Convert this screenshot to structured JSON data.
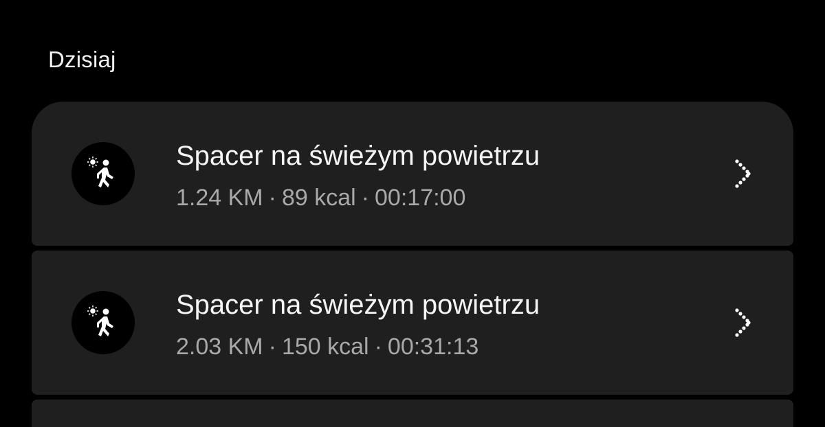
{
  "header": {
    "section_title": "Dzisiaj"
  },
  "activities": [
    {
      "title": "Spacer na świeżym powietrzu",
      "distance": "1.24 KM",
      "calories": "89 kcal",
      "duration": "00:17:00",
      "icon": "outdoor-walk-icon"
    },
    {
      "title": "Spacer na świeżym powietrzu",
      "distance": "2.03 KM",
      "calories": "150 kcal",
      "duration": "00:31:13",
      "icon": "outdoor-walk-icon"
    }
  ],
  "separator": "·",
  "colors": {
    "background": "#000000",
    "card": "#1f1f1f",
    "title_text": "#f5f5f5",
    "secondary_text": "#a9a9a9"
  }
}
